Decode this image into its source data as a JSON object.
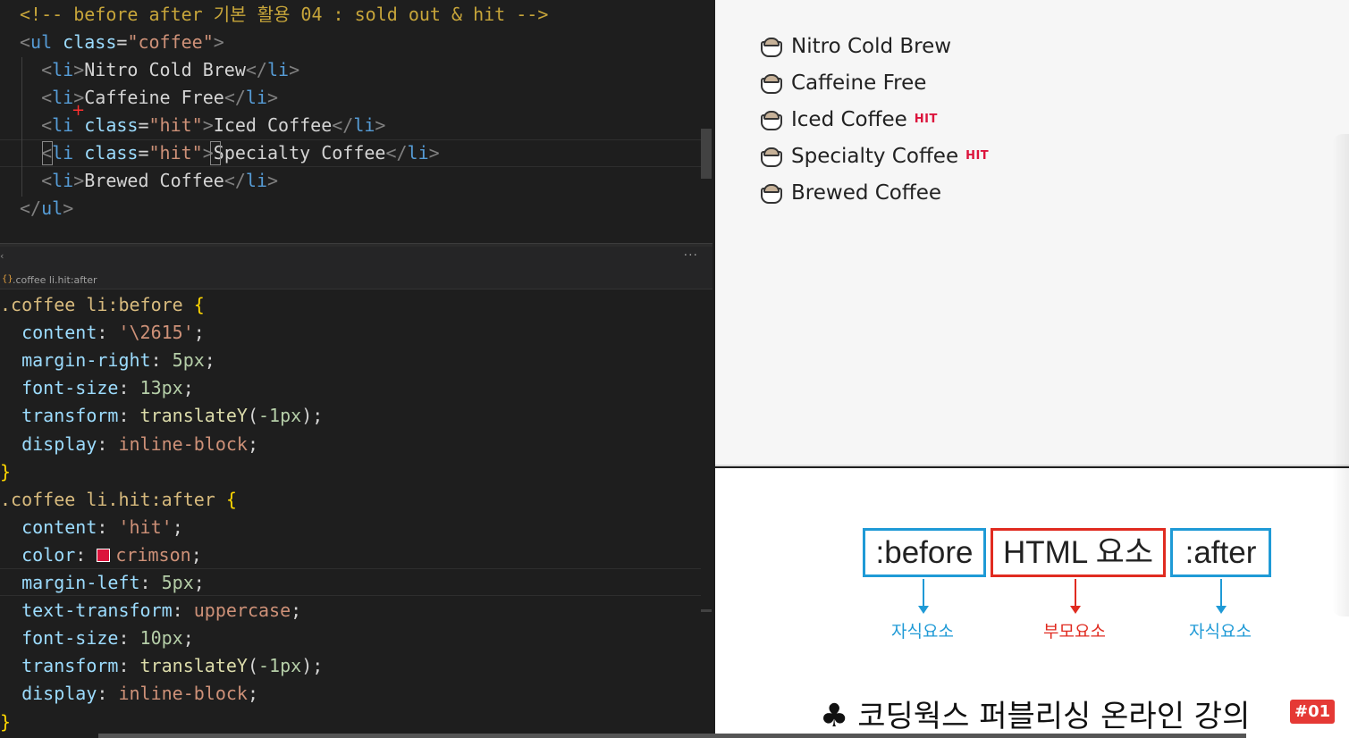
{
  "editor": {
    "html_lines": [
      [
        [
          "tk-comment",
          "<!-- before after 기본 활용 04 : sold out & hit -->"
        ]
      ],
      [
        [
          "tk-tag",
          "<"
        ],
        [
          "tk-name",
          "ul "
        ],
        [
          "tk-attr",
          "class"
        ],
        [
          "tk-punc",
          "="
        ],
        [
          "tk-str",
          "\"coffee\""
        ],
        [
          "tk-tag",
          ">"
        ]
      ],
      [
        [
          "tk-tag",
          "  <"
        ],
        [
          "tk-name",
          "li"
        ],
        [
          "tk-tag",
          ">"
        ],
        [
          "tk-text",
          "Nitro Cold Brew"
        ],
        [
          "tk-tag",
          "</"
        ],
        [
          "tk-name",
          "li"
        ],
        [
          "tk-tag",
          ">"
        ]
      ],
      [
        [
          "tk-tag",
          "  <"
        ],
        [
          "tk-name",
          "li"
        ],
        [
          "tk-tag",
          ">"
        ],
        [
          "tk-text",
          "Caffeine Free"
        ],
        [
          "tk-tag",
          "</"
        ],
        [
          "tk-name",
          "li"
        ],
        [
          "tk-tag",
          ">"
        ]
      ],
      [
        [
          "tk-tag",
          "  <"
        ],
        [
          "tk-name",
          "li "
        ],
        [
          "tk-attr",
          "class"
        ],
        [
          "tk-punc",
          "="
        ],
        [
          "tk-str",
          "\"hit\""
        ],
        [
          "tk-tag",
          ">"
        ],
        [
          "tk-text",
          "Iced Coffee"
        ],
        [
          "tk-tag",
          "</"
        ],
        [
          "tk-name",
          "li"
        ],
        [
          "tk-tag",
          ">"
        ]
      ],
      [
        [
          "tk-tag",
          "  <"
        ],
        [
          "tk-name",
          "li "
        ],
        [
          "tk-attr",
          "class"
        ],
        [
          "tk-punc",
          "="
        ],
        [
          "tk-str",
          "\"hit\""
        ],
        [
          "tk-tag",
          ">"
        ],
        [
          "tk-text",
          "Specialty Coffee"
        ],
        [
          "tk-tag",
          "</"
        ],
        [
          "tk-name",
          "li"
        ],
        [
          "tk-tag",
          ">"
        ]
      ],
      [
        [
          "tk-tag",
          "  <"
        ],
        [
          "tk-name",
          "li"
        ],
        [
          "tk-tag",
          ">"
        ],
        [
          "tk-text",
          "Brewed Coffee"
        ],
        [
          "tk-tag",
          "</"
        ],
        [
          "tk-name",
          "li"
        ],
        [
          "tk-tag",
          ">"
        ]
      ],
      [
        [
          "tk-tag",
          "</"
        ],
        [
          "tk-name",
          "ul"
        ],
        [
          "tk-tag",
          ">"
        ]
      ]
    ],
    "breadcrumb": ".coffee li.hit:after",
    "breadcrumb_icon": "{}",
    "more_actions": "···",
    "collapse_marker": "‹",
    "css_lines": [
      [
        [
          "tk-sel",
          ".coffee li:before "
        ],
        [
          "tk-brace",
          "{"
        ]
      ],
      [
        [
          "tk-prop",
          "  content"
        ],
        [
          "tk-punc",
          ": "
        ],
        [
          "tk-val",
          "'\\2615'"
        ],
        [
          "tk-punc",
          ";"
        ]
      ],
      [
        [
          "tk-prop",
          "  margin-right"
        ],
        [
          "tk-punc",
          ": "
        ],
        [
          "tk-num",
          "5px"
        ],
        [
          "tk-punc",
          ";"
        ]
      ],
      [
        [
          "tk-prop",
          "  font-size"
        ],
        [
          "tk-punc",
          ": "
        ],
        [
          "tk-num",
          "13px"
        ],
        [
          "tk-punc",
          ";"
        ]
      ],
      [
        [
          "tk-prop",
          "  transform"
        ],
        [
          "tk-punc",
          ": "
        ],
        [
          "tk-fn",
          "translateY"
        ],
        [
          "tk-punc",
          "("
        ],
        [
          "tk-num",
          "-1px"
        ],
        [
          "tk-punc",
          ");"
        ]
      ],
      [
        [
          "tk-prop",
          "  display"
        ],
        [
          "tk-punc",
          ": "
        ],
        [
          "tk-val",
          "inline-block"
        ],
        [
          "tk-punc",
          ";"
        ]
      ],
      [
        [
          "tk-brace",
          "}"
        ]
      ],
      [
        [
          "tk-sel",
          ".coffee li.hit:after "
        ],
        [
          "tk-brace",
          "{"
        ]
      ],
      [
        [
          "tk-prop",
          "  content"
        ],
        [
          "tk-punc",
          ": "
        ],
        [
          "tk-val",
          "'hit'"
        ],
        [
          "tk-punc",
          ";"
        ]
      ],
      [
        [
          "tk-prop",
          "  color"
        ],
        [
          "tk-punc",
          ": "
        ],
        [
          "swatch",
          ""
        ],
        [
          "tk-val",
          "crimson"
        ],
        [
          "tk-punc",
          ";"
        ]
      ],
      [
        [
          "tk-prop",
          "  margin-left"
        ],
        [
          "tk-punc",
          ": "
        ],
        [
          "tk-num",
          "5px"
        ],
        [
          "tk-punc",
          ";"
        ]
      ],
      [
        [
          "tk-prop",
          "  text-transform"
        ],
        [
          "tk-punc",
          ": "
        ],
        [
          "tk-val",
          "uppercase"
        ],
        [
          "tk-punc",
          ";"
        ]
      ],
      [
        [
          "tk-prop",
          "  font-size"
        ],
        [
          "tk-punc",
          ": "
        ],
        [
          "tk-num",
          "10px"
        ],
        [
          "tk-punc",
          ";"
        ]
      ],
      [
        [
          "tk-prop",
          "  transform"
        ],
        [
          "tk-punc",
          ": "
        ],
        [
          "tk-fn",
          "translateY"
        ],
        [
          "tk-punc",
          "("
        ],
        [
          "tk-num",
          "-1px"
        ],
        [
          "tk-punc",
          ");"
        ]
      ],
      [
        [
          "tk-prop",
          "  display"
        ],
        [
          "tk-punc",
          ": "
        ],
        [
          "tk-val",
          "inline-block"
        ],
        [
          "tk-punc",
          ";"
        ]
      ],
      [
        [
          "tk-brace",
          "}"
        ]
      ]
    ],
    "swatch_color": "#dc143c"
  },
  "preview": {
    "items": [
      {
        "label": "Nitro Cold Brew",
        "hit": ""
      },
      {
        "label": "Caffeine Free",
        "hit": ""
      },
      {
        "label": "Iced Coffee",
        "hit": "HIT"
      },
      {
        "label": "Specialty Coffee",
        "hit": "HIT"
      },
      {
        "label": "Brewed Coffee",
        "hit": ""
      }
    ],
    "hit_color": "#dc143c"
  },
  "slide": {
    "box_before": ":before",
    "box_html": "HTML 요소",
    "box_after": ":after",
    "label_before": "자식요소",
    "label_html": "부모요소",
    "label_after": "자식요소",
    "child_color": "#1f9ad6",
    "parent_color": "#e02b20",
    "course_icon": "♣",
    "course_title": "코딩웍스 퍼블리싱 온라인 강의",
    "episode_badge": "#01"
  }
}
